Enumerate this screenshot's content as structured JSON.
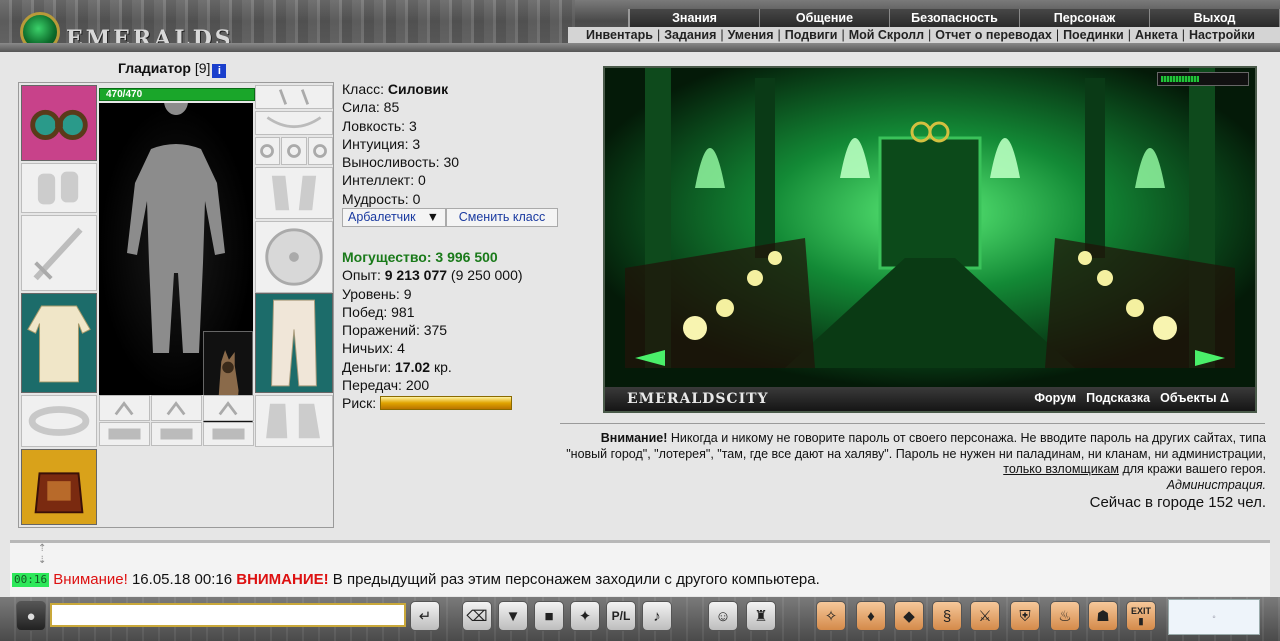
{
  "header": {
    "logo_text": "EMERALDS",
    "top_menu": [
      "Знания",
      "Общение",
      "Безопасность",
      "Персонаж",
      "Выход"
    ],
    "sub_menu": [
      "Инвентарь",
      "Задания",
      "Умения",
      "Подвиги",
      "Мой Скролл",
      "Отчет о переводах",
      "Поединки",
      "Анкета",
      "Настройки"
    ]
  },
  "character": {
    "name": "Гладиатор",
    "level": "[9]",
    "info_icon": "i",
    "hp": "470/470"
  },
  "stats": {
    "class_label": "Класс:",
    "class_value": "Силовик",
    "strength": "Сила: 85",
    "agility": "Ловкость: 3",
    "intuition": "Интуиция: 3",
    "endurance": "Выносливость: 30",
    "intellect": "Интеллект: 0",
    "wisdom": "Мудрость: 0"
  },
  "class_select": {
    "value": "Арбалетчик",
    "change_button": "Сменить класс"
  },
  "stats2": {
    "power_label": "Могущество:",
    "power_value": "3 996 500",
    "exp_label": "Опыт:",
    "exp_value": "9 213 077",
    "exp_next": "(9 250 000)",
    "level": "Уровень: 9",
    "wins": "Побед: 981",
    "losses": "Поражений: 375",
    "draws": "Ничьих: 4",
    "money_label": "Деньги:",
    "money_value": "17.02",
    "money_unit": "кр.",
    "transfers": "Передач: 200",
    "risk_label": "Риск:"
  },
  "scene": {
    "title": "EMERALDSCITY",
    "links": [
      "Форум",
      "Подсказка",
      "Объекты Δ"
    ]
  },
  "warning": {
    "bold": "Внимание!",
    "text1": "Никогда и никому не говорите пароль от своего персонажа. Не вводите пароль на других сайтах, типа \"новый город\", \"лотерея\", \"там, где все дают на халяву\". Пароль не нужен ни паладинам, ни кланам, ни администрации,",
    "underlined": "только взломщикам",
    "text2": "для кражи вашего героя.",
    "signature": "Администрация."
  },
  "online": "Сейчас в городе 152 чел.",
  "chat": {
    "time": "00:16",
    "attention": "Внимание!",
    "date": "16.05.18 00:16",
    "attention_caps": "ВНИМАНИЕ!",
    "message": "В предыдущий раз этим персонажем заходили с другого компьютера."
  },
  "toolbar": {
    "icons": [
      "enter-icon",
      "clear-icon",
      "filter-icon",
      "save-icon",
      "walk-icon",
      "pl-icon",
      "sound-icon",
      "smile-icon",
      "helmet-icon",
      "magic-icon",
      "bag-icon",
      "gold-icon",
      "scroll-icon",
      "fight-icon",
      "armor-icon",
      "potion-icon",
      "team-icon",
      "exit-icon"
    ],
    "exit_label": "EXIT"
  }
}
